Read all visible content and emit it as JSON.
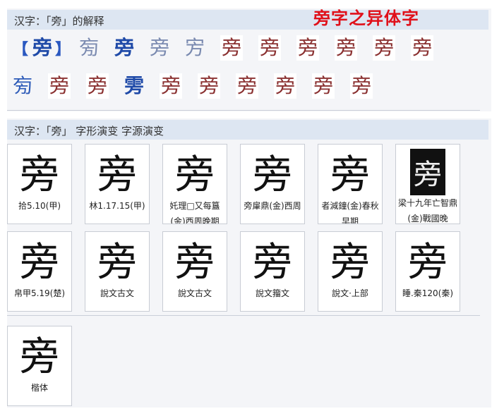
{
  "section1": {
    "header": "汉字：「旁」的解释",
    "title_art": "旁字之异体字",
    "main_char": "旁",
    "row1": [
      {
        "ch": "㫄",
        "style": "light"
      },
      {
        "ch": "旁",
        "style": "blue bold"
      },
      {
        "ch": "旁",
        "style": "light"
      },
      {
        "ch": "㝑",
        "style": "light"
      },
      {
        "ch": "旁",
        "style": "red"
      },
      {
        "ch": "旁",
        "style": "red"
      },
      {
        "ch": "旁",
        "style": "red"
      },
      {
        "ch": "旁",
        "style": "red"
      },
      {
        "ch": "旁",
        "style": "red"
      },
      {
        "ch": "旁",
        "style": "red"
      }
    ],
    "row2": [
      {
        "ch": "㫄",
        "style": "blue"
      },
      {
        "ch": "旁",
        "style": "red"
      },
      {
        "ch": "旁",
        "style": "red"
      },
      {
        "ch": "雱",
        "style": "blue bold"
      },
      {
        "ch": "旁",
        "style": "red"
      },
      {
        "ch": "旁",
        "style": "red"
      },
      {
        "ch": "旁",
        "style": "red"
      },
      {
        "ch": "旁",
        "style": "red"
      },
      {
        "ch": "旁",
        "style": "red"
      },
      {
        "ch": "旁",
        "style": "red"
      }
    ]
  },
  "section2": {
    "header": "汉字：「旁」 字形演变 字源演变",
    "cards": [
      {
        "glyph": "旁",
        "cap": "拾5.10(甲)"
      },
      {
        "glyph": "旁",
        "cap": "林1.17.15(甲)"
      },
      {
        "glyph": "旁",
        "cap": "奼理□又每簋(金)西周晚期"
      },
      {
        "glyph": "旁",
        "cap": "旁肁鼎(金)西周"
      },
      {
        "glyph": "旁",
        "cap": "者減鐘(金)春秋早期"
      },
      {
        "glyph": "旁",
        "cap": "梁十九年亡智鼎(金)戰國晚",
        "dark": true
      },
      {
        "glyph": "旁",
        "cap": "帛甲5.19(楚)"
      },
      {
        "glyph": "旁",
        "cap": "說文古文"
      },
      {
        "glyph": "旁",
        "cap": "說文古文"
      },
      {
        "glyph": "旁",
        "cap": "說文籀文"
      },
      {
        "glyph": "旁",
        "cap": "說文·上部"
      },
      {
        "glyph": "旁",
        "cap": "睡.秦120(秦)"
      },
      {
        "glyph": "旁",
        "cap": "楷体"
      }
    ]
  }
}
